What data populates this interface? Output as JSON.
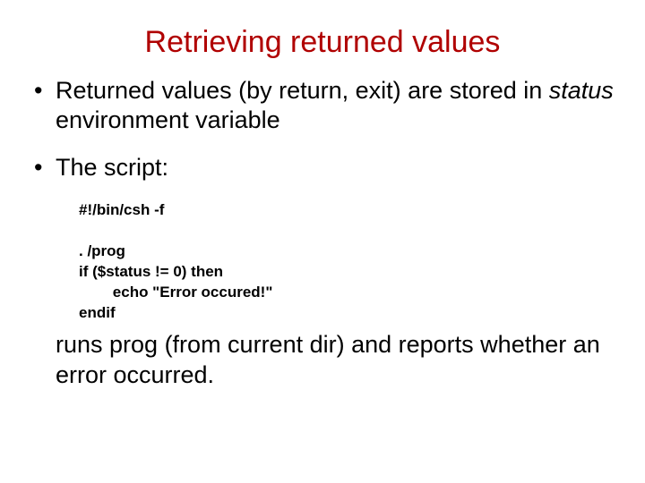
{
  "title": "Retrieving returned values",
  "bullet1_pre": "Returned values (by return, exit) are stored in ",
  "bullet1_em": "status",
  "bullet1_post": " environment variable",
  "bullet2": "The script:",
  "code_line1": "#!/bin/csh -f",
  "code_line2": ". /prog",
  "code_line3": "if ($status != 0) then",
  "code_line4": "        echo \"Error occured!\"",
  "code_line5": "endif",
  "closing": "runs prog (from current dir) and reports whether an error occurred."
}
